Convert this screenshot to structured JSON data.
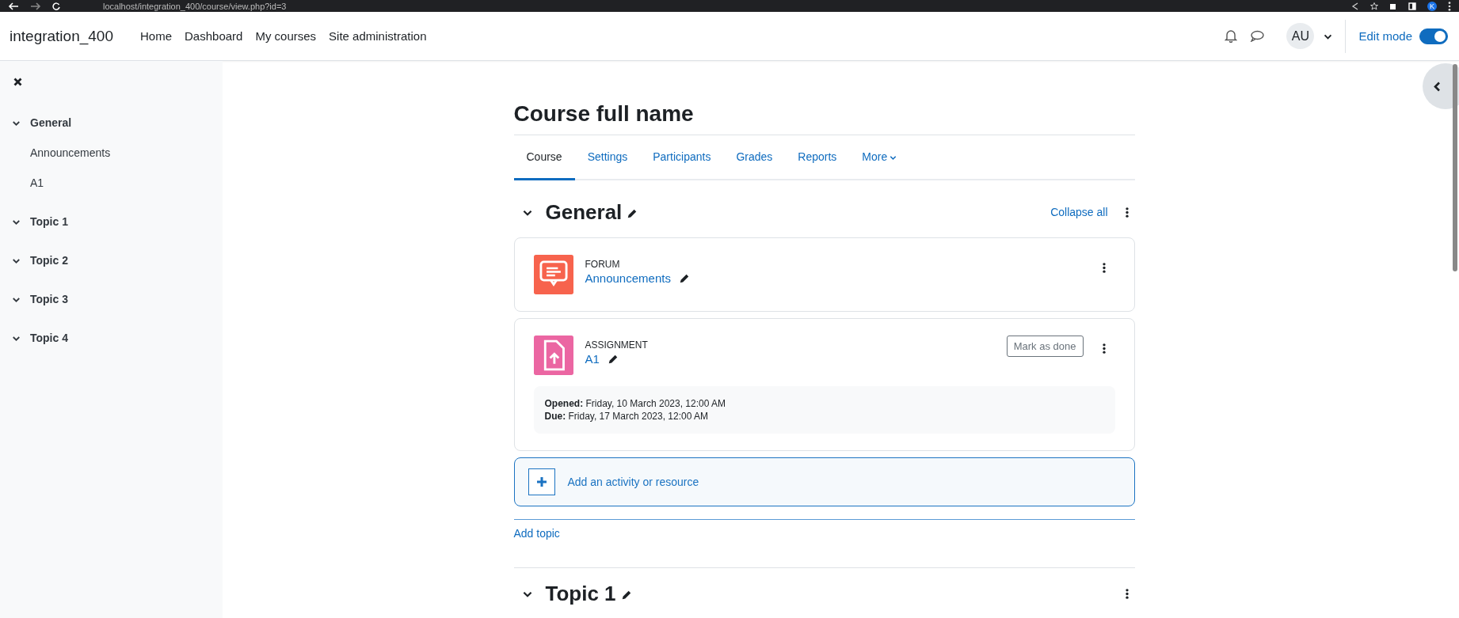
{
  "browser": {
    "url": "localhost/integration_400/course/view.php?id=3",
    "profile": "K"
  },
  "navbar": {
    "site_name": "integration_400",
    "links": [
      {
        "label": "Home"
      },
      {
        "label": "Dashboard"
      },
      {
        "label": "My courses"
      },
      {
        "label": "Site administration"
      }
    ],
    "user_initials": "AU",
    "edit_mode": {
      "label": "Edit mode",
      "on": true
    }
  },
  "sidebar": {
    "sections": [
      {
        "title": "General",
        "expanded": true,
        "items": [
          {
            "label": "Announcements"
          },
          {
            "label": "A1"
          }
        ]
      },
      {
        "title": "Topic 1",
        "expanded": true
      },
      {
        "title": "Topic 2",
        "expanded": true
      },
      {
        "title": "Topic 3",
        "expanded": true
      },
      {
        "title": "Topic 4",
        "expanded": true
      }
    ]
  },
  "course": {
    "title": "Course full name",
    "tabs": [
      {
        "label": "Course",
        "selected": true,
        "dropdown": false
      },
      {
        "label": "Settings",
        "selected": false,
        "dropdown": false
      },
      {
        "label": "Participants",
        "selected": false,
        "dropdown": false
      },
      {
        "label": "Grades",
        "selected": false,
        "dropdown": false
      },
      {
        "label": "Reports",
        "selected": false,
        "dropdown": false
      },
      {
        "label": "More",
        "selected": false,
        "dropdown": true
      }
    ],
    "sections": [
      {
        "title": "General",
        "expanded": true,
        "collapse_all": "Collapse all",
        "activities": [
          {
            "kind": "forum",
            "type_label": "FORUM",
            "name": "Announcements"
          },
          {
            "kind": "assignment",
            "type_label": "ASSIGNMENT",
            "name": "A1",
            "mark_button": "Mark as done",
            "dates": [
              {
                "label": "Opened:",
                "value": "Friday, 10 March 2023, 12:00 AM"
              },
              {
                "label": "Due:",
                "value": "Friday, 17 March 2023, 12:00 AM"
              }
            ]
          }
        ],
        "add_activity": "Add an activity or resource",
        "add_topic": "Add topic"
      },
      {
        "title": "Topic 1",
        "expanded": true
      }
    ]
  }
}
